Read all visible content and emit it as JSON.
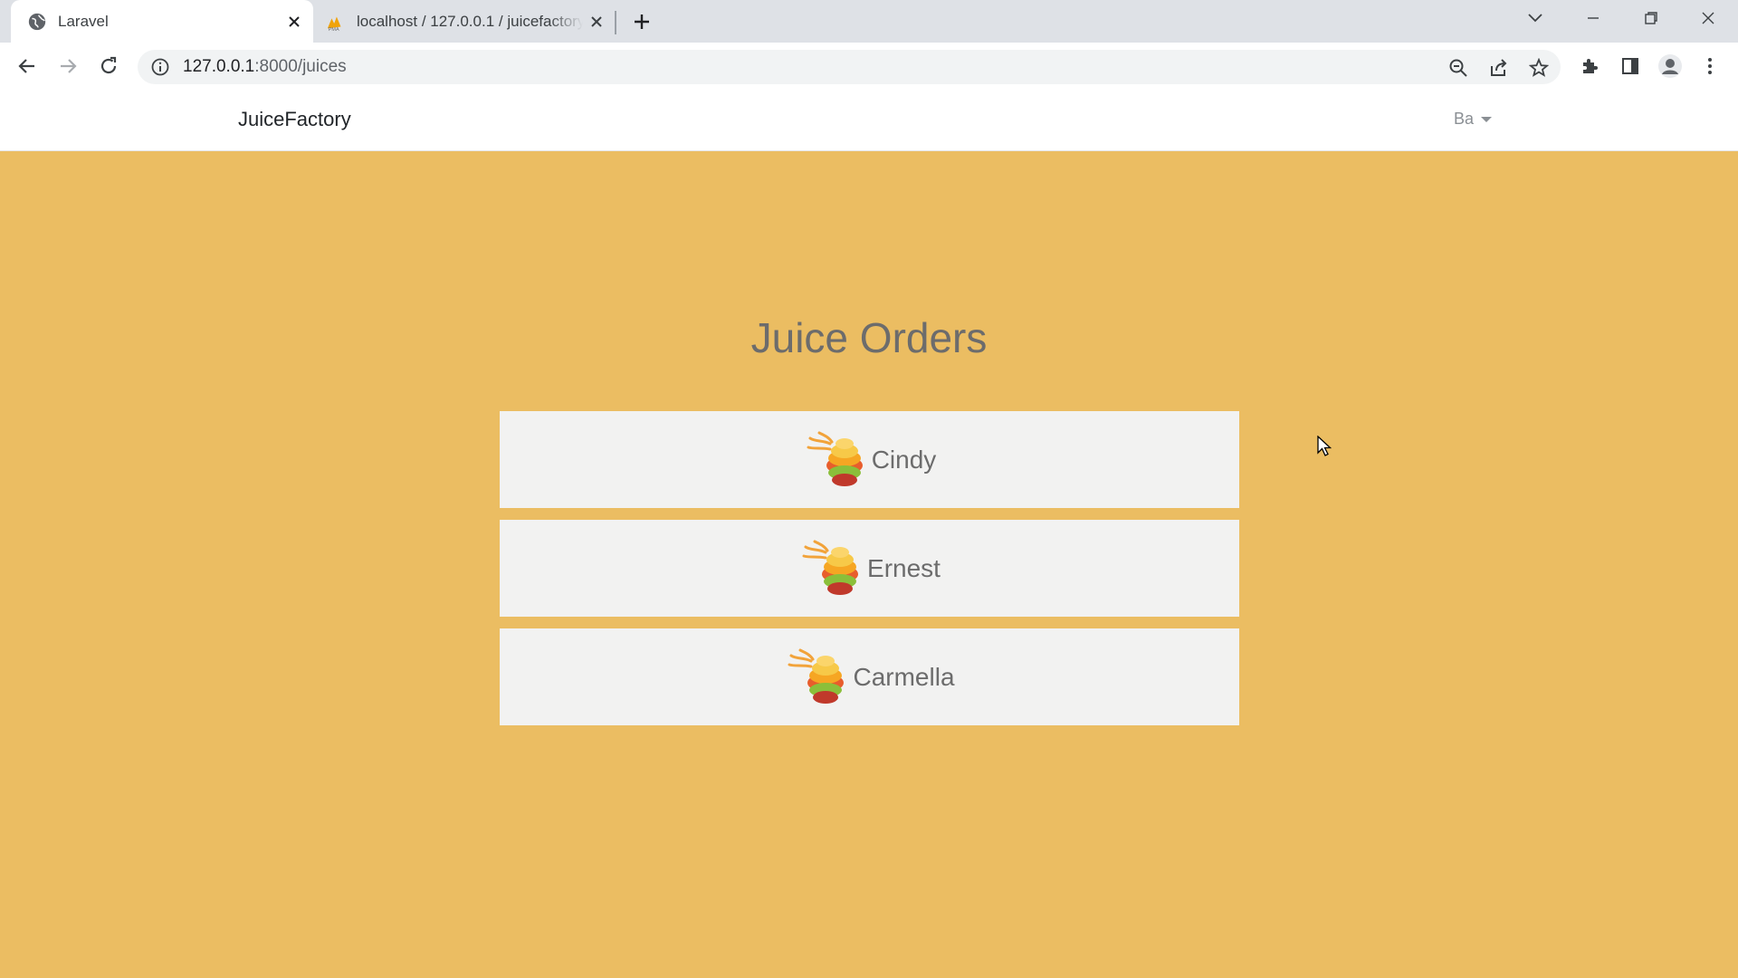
{
  "browser": {
    "tabs": [
      {
        "title": "Laravel",
        "favicon": "globe-icon",
        "active": true
      },
      {
        "title": "localhost / 127.0.0.1 / juicefactory",
        "favicon": "phpmyadmin-icon",
        "active": false
      }
    ],
    "url_host": "127.0.0.1",
    "url_rest": ":8000/juices"
  },
  "site": {
    "brand": "JuiceFactory",
    "user": "Ba"
  },
  "page": {
    "title": "Juice Orders",
    "orders": [
      {
        "name": "Cindy"
      },
      {
        "name": "Ernest"
      },
      {
        "name": "Carmella"
      }
    ]
  },
  "colors": {
    "background": "#ebbd62",
    "card": "#f2f2f1",
    "text_muted": "#6c6c6c"
  }
}
